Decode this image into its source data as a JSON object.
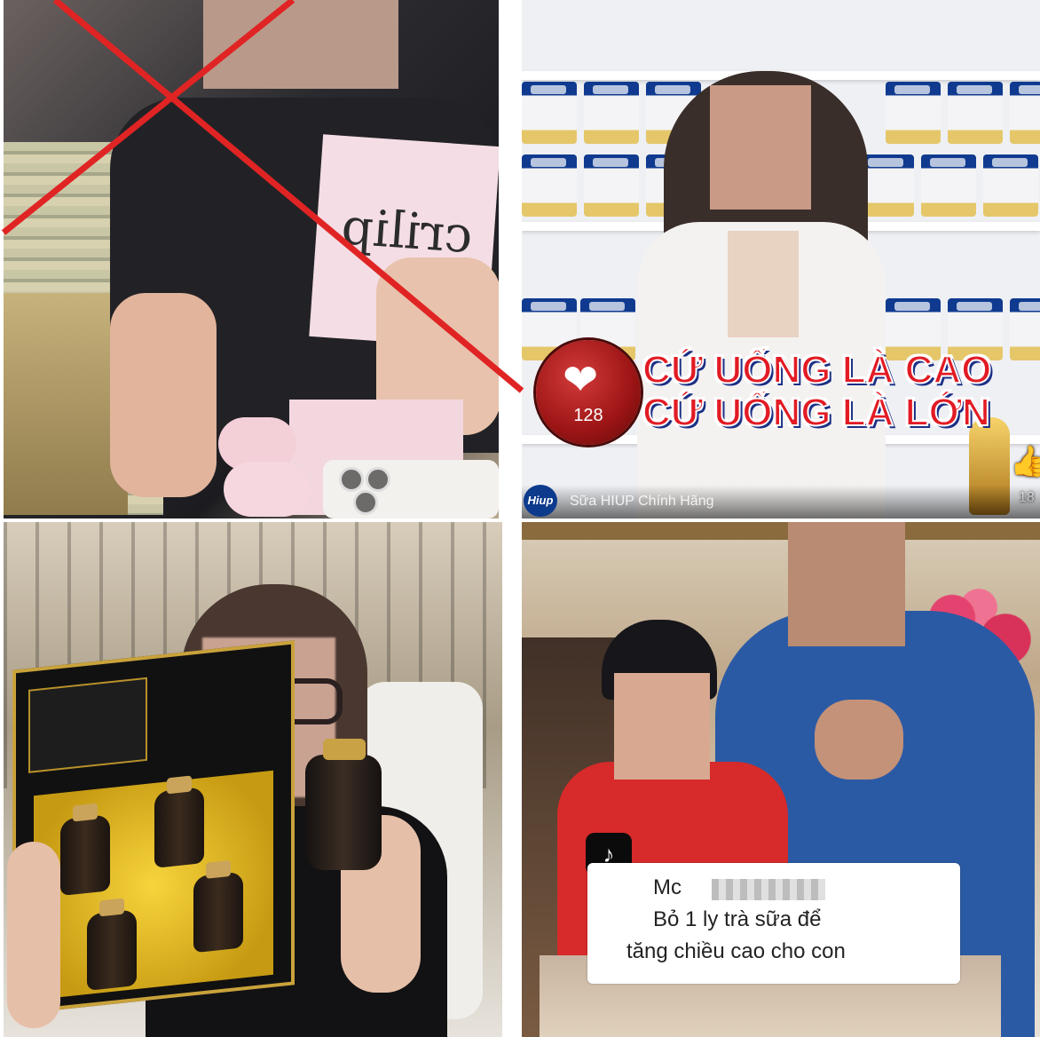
{
  "panels": {
    "top_left": {
      "box_text": "crilip",
      "crossed_out": true,
      "cross_color": "#e02424"
    },
    "top_right": {
      "like_count": "128",
      "side_count": "18",
      "slogan_line1": "CỨ UỐNG LÀ CAO",
      "slogan_line2": "CỨ UỐNG LÀ LỚN",
      "channel_logo": "Hiup",
      "channel_name": "Sữa HIUP Chính Hãng",
      "can_brand": "Hiup",
      "slogan_color": "#e21b24"
    },
    "bottom_left": {},
    "bottom_right": {
      "caption_line1": "Mc",
      "caption_line2": "Bỏ 1 ly trà sữa để",
      "caption_line3": "tăng chiều cao cho con",
      "platform_icon": "tiktok-icon"
    }
  }
}
